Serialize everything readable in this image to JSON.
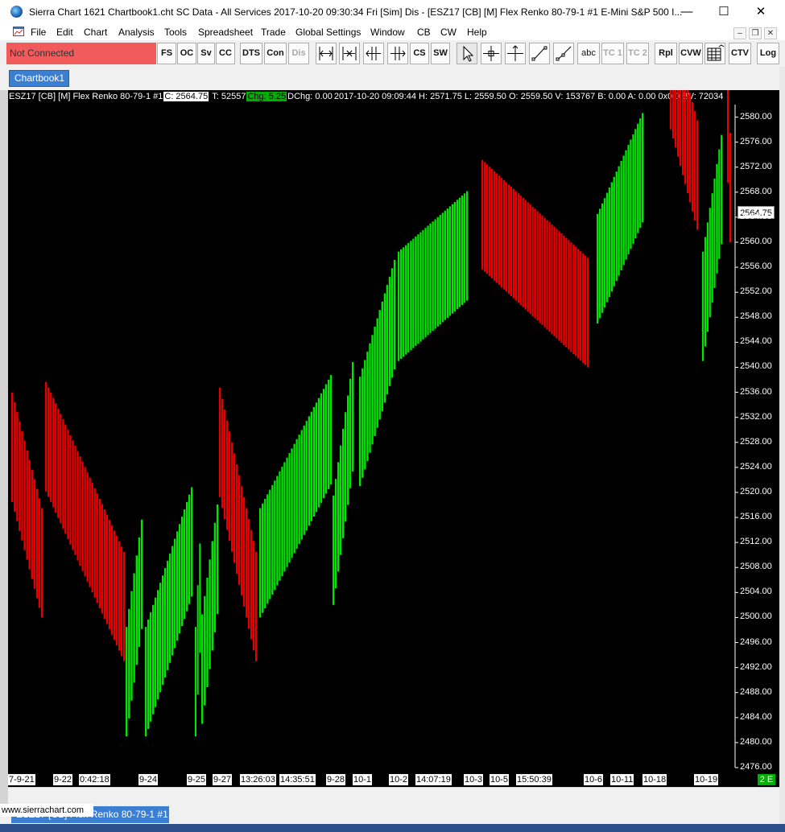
{
  "window": {
    "title": "Sierra Chart 1621 Chartbook1.cht  SC Data - All Services 2017-10-20  09:30:34 Fri [Sim]  Dis - [ESZ17 [CB] [M]  Flex Renko 80-79-1  #1  E-Mini S&P 500 I...",
    "minimize": "—",
    "maximize": "☐",
    "close": "✕"
  },
  "menu": {
    "items": [
      "File",
      "Edit",
      "Chart",
      "Analysis",
      "Tools",
      "Spreadsheet",
      "Trade",
      "Global Settings",
      "Window",
      "CB",
      "CW",
      "Help"
    ],
    "mdi_minimize": "–",
    "mdi_restore": "❐",
    "mdi_close": "✕"
  },
  "toolbar": {
    "connection_status": "Not Connected",
    "buttons": [
      "FS",
      "OC",
      "Sv",
      "CC",
      "DTS",
      "Con",
      "Dis"
    ],
    "tools_text": [
      "CS",
      "SW",
      "abc",
      "TC 1",
      "TC 2",
      "Rpl",
      "CVW",
      "CTV",
      "Log"
    ],
    "icons": [
      "zoom-out-icon",
      "zoom-in-icon",
      "scroll-left-icon",
      "scroll-right-icon",
      "pointer-icon",
      "crosshair-icon",
      "values-tool-icon",
      "line-tool-icon",
      "ray-tool-icon",
      "table-icon"
    ]
  },
  "tabs": {
    "active": "Chartbook1"
  },
  "chart_header": {
    "symbol": "ESZ17 [CB] [M]  Flex Renko 80-79-1  #1",
    "close": "C: 2564.75",
    "trades": "T: 52557",
    "change": "Chg: 5.25",
    "dchange": "DChg: 0.00",
    "rest": "2017-10-20 09:09:44 H: 2571.75 L: 2559.50 O: 2559.50 V: 153767 B: 0.00 A: 0.00 0x0 0 BV: 72034"
  },
  "chart_data": {
    "type": "candlestick",
    "instrument": "ESZ17",
    "bar_type": "Flex Renko 80-79-1",
    "last_price": 2564.75,
    "ylim": [
      2476,
      2582
    ],
    "y_ticks": [
      2580.0,
      2576.0,
      2572.0,
      2568.0,
      2564.0,
      2560.0,
      2556.0,
      2552.0,
      2548.0,
      2544.0,
      2540.0,
      2536.0,
      2532.0,
      2528.0,
      2524.0,
      2520.0,
      2516.0,
      2512.0,
      2508.0,
      2504.0,
      2500.0,
      2496.0,
      2492.0,
      2488.0,
      2484.0,
      2480.0,
      2476.0
    ],
    "x_tick_labels": [
      "7-9-21",
      "9-22",
      "0:42:18",
      "9-24",
      "9-25",
      "9-27",
      "13:26:03",
      "14:35:51",
      "9-28",
      "10-1",
      "10-2",
      "14:07:19",
      "10-3",
      "10-5",
      "15:50:39",
      "10-6",
      "10-11",
      "10-18",
      "10-19"
    ],
    "up_color": "#00e600",
    "down_color": "#e60000",
    "segments": [
      {
        "dir": "down",
        "start": 2520.0,
        "end": 2500.0
      },
      {
        "dir": "down",
        "start": 2521.0,
        "end": 2493.0
      },
      {
        "dir": "up",
        "start": 2481.0,
        "end": 2501.0
      },
      {
        "dir": "up",
        "start": 2481.0,
        "end": 2504.5
      },
      {
        "dir": "up",
        "start": 2481.0,
        "end": 2501.0
      },
      {
        "dir": "up",
        "start": 2483.0,
        "end": 2503.5
      },
      {
        "dir": "down",
        "start": 2521.0,
        "end": 2493.0
      },
      {
        "dir": "up",
        "start": 2500.0,
        "end": 2522.0
      },
      {
        "dir": "up",
        "start": 2502.0,
        "end": 2526.0
      },
      {
        "dir": "up",
        "start": 2521.0,
        "end": 2541.0
      },
      {
        "dir": "up",
        "start": 2541.0,
        "end": 2551.0
      },
      {
        "dir": "down",
        "start": 2556.0,
        "end": 2540.0
      },
      {
        "dir": "up",
        "start": 2547.0,
        "end": 2564.0
      },
      {
        "dir": "down",
        "start": 2579.5,
        "end": 2562.0
      },
      {
        "dir": "up",
        "start": 2541.0,
        "end": 2562.0
      },
      {
        "dir": "down",
        "start": 2579.0,
        "end": 2560.0
      }
    ]
  },
  "date_axis": {
    "status": "2 E"
  },
  "bottom": {
    "tab_label": "ESZ17 [CB]   Flex Renko 80-79-1  #1",
    "watermark": "www.sierrachart.com"
  }
}
